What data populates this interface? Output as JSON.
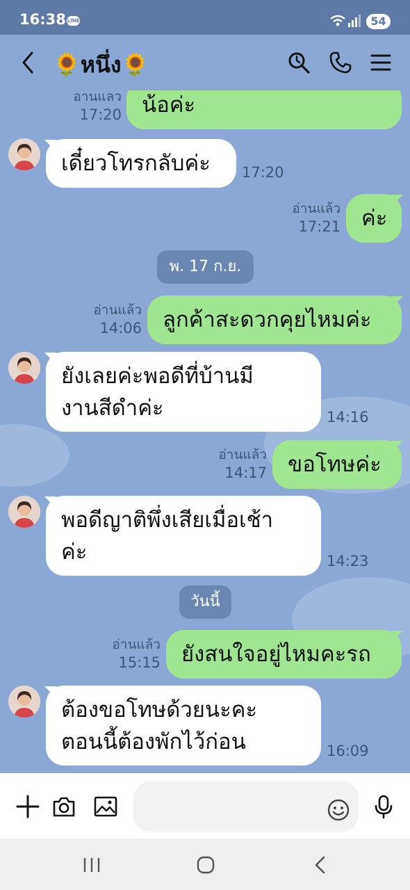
{
  "status_bar": {
    "time": "16:38",
    "line_badge": "LINE",
    "battery": "54"
  },
  "header": {
    "title": "🌻หนึ่ง🌻"
  },
  "date_dividers": {
    "d1": "พ. 17 ก.ย.",
    "d2": "วันนี้"
  },
  "messages": [
    {
      "dir": "out",
      "text": "น้อค่ะ",
      "read": "อานแลว",
      "time": "17:20"
    },
    {
      "dir": "in",
      "lines": [
        "เดี๋ยวโทรกลับค่ะ"
      ],
      "time": "17:20"
    },
    {
      "dir": "out",
      "text": "ค่ะ",
      "read": "อ่านแล้ว",
      "time": "17:21"
    },
    {
      "dir": "out",
      "text": "ลูกค้าสะดวกคุยไหมค่ะ",
      "read": "อ่านแล้ว",
      "time": "14:06"
    },
    {
      "dir": "in",
      "lines": [
        "ยังเลยค่ะพอดีที่บ้านมี",
        "งานสีดำค่ะ"
      ],
      "time": "14:16"
    },
    {
      "dir": "out",
      "text": "ขอโทษค่ะ",
      "read": "อ่านแล้ว",
      "time": "14:17"
    },
    {
      "dir": "in",
      "lines": [
        "พอดีญาติพึ่งเสียเมื่อเช้า",
        "ค่ะ"
      ],
      "time": "14:23"
    },
    {
      "dir": "out",
      "text": "ยังสนใจอยู่ไหมคะรถ",
      "read": "อ่านแล้ว",
      "time": "15:15"
    },
    {
      "dir": "in",
      "lines": [
        "ต้องขอโทษด้วยนะคะ",
        "ตอนนี้ต้องพักไว้ก่อน"
      ],
      "time": "16:09"
    }
  ],
  "input": {
    "placeholder": ""
  },
  "icons": {
    "back": "chevron-left-icon",
    "search": "search-icon",
    "call": "phone-icon",
    "menu": "menu-icon",
    "add": "plus-icon",
    "camera": "camera-icon",
    "image": "image-icon",
    "emoji": "emoji-icon",
    "mic": "mic-icon"
  },
  "colors": {
    "background": "#8aa7d6",
    "outgoing_bubble": "#9ee690",
    "incoming_bubble": "#ffffff",
    "status_bar": "#5f7aa8"
  }
}
